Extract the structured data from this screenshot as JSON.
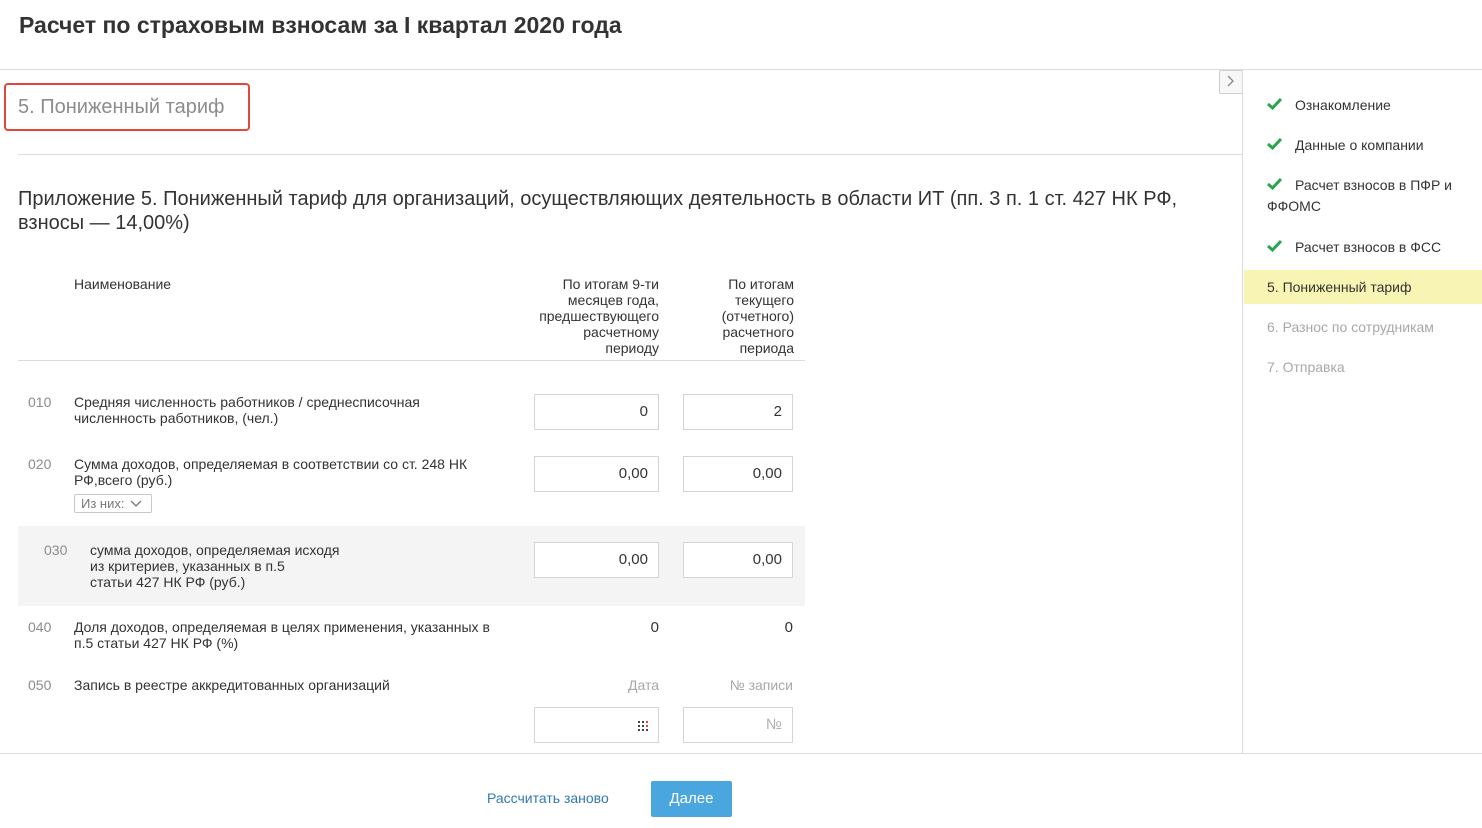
{
  "header": {
    "title": "Расчет по страховым взносам за I квартал 2020 года"
  },
  "section": {
    "title": "5. Пониженный тариф",
    "appendix_title": "Приложение 5. Пониженный тариф для организаций, осуществляющих деятельность в области ИТ (пп. 3 п. 1 ст. 427 НК РФ, взносы — 14,00%)"
  },
  "table": {
    "col_name": "Наименование",
    "col_period1": [
      "По итогам 9-ти",
      "месяцев года,",
      "предшествующего",
      "расчетному",
      "периоду"
    ],
    "col_period2": [
      "По итогам",
      "текущего",
      "(отчетного)",
      "расчетного",
      "периода"
    ],
    "rows": {
      "r010": {
        "code": "010",
        "label": [
          "Средняя численность работников / среднесписочная",
          "численность работников, (чел.)"
        ],
        "v1": "0",
        "v2": "2"
      },
      "r020": {
        "code": "020",
        "label": [
          "Сумма доходов, определяемая в соответствии со ст. 248 НК",
          "РФ,всего (руб.)"
        ],
        "v1": "0,00",
        "v2": "0,00",
        "from_label": "Из них:"
      },
      "r030": {
        "code": "030",
        "label": [
          "сумма доходов, определяемая исходя",
          "из критериев, указанных в п.5",
          "статьи 427 НК РФ (руб.)"
        ],
        "v1": "0,00",
        "v2": "0,00"
      },
      "r040": {
        "code": "040",
        "label": [
          "Доля доходов, определяемая в целях применения, указанных в",
          "п.5 статьи 427 НК РФ (%)"
        ],
        "v1": "0",
        "v2": "0"
      },
      "r050": {
        "code": "050",
        "label": "Запись в реестре аккредитованных организаций",
        "hint1": "Дата",
        "hint2": "№ записи",
        "v1": "",
        "placeholder2": "№"
      }
    }
  },
  "sidebar": {
    "steps": [
      {
        "label": "Ознакомление",
        "state": "done"
      },
      {
        "label": "Данные о компании",
        "state": "done"
      },
      {
        "label": "Расчет взносов в ПФР и ФФОМС",
        "state": "done"
      },
      {
        "label": "Расчет взносов в ФСС",
        "state": "done"
      },
      {
        "label": "5.  Пониженный тариф",
        "state": "active"
      },
      {
        "label": "6.  Разнос по сотрудникам",
        "state": "disabled"
      },
      {
        "label": "7.  Отправка",
        "state": "disabled"
      }
    ]
  },
  "footer": {
    "recalc_label": "Рассчитать заново",
    "next_label": "Далее"
  },
  "icons": {
    "check": "check-icon",
    "calendar": "calendar-icon",
    "chevron": "chevron-down-icon",
    "collapse": "chevron-right-icon"
  },
  "colors": {
    "accent": "#4aa6df",
    "link": "#3178b6",
    "check": "#2aa44f",
    "highlight": "#f8f5b4",
    "frame": "#e3473b"
  }
}
